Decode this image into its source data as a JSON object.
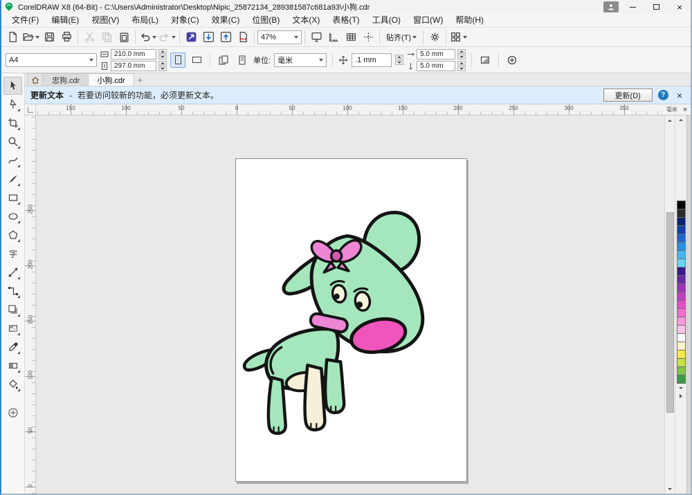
{
  "window": {
    "title": "CorelDRAW X8 (64-Bit) - C:\\Users\\Administrator\\Desktop\\Nipic_25872134_289381587c681a93\\小狗.cdr",
    "app_icon": "coreldraw-balloon-icon",
    "close_glyph": "×"
  },
  "menu": {
    "items": [
      "文件(F)",
      "编辑(E)",
      "视图(V)",
      "布局(L)",
      "对象(C)",
      "效果(C)",
      "位图(B)",
      "文本(X)",
      "表格(T)",
      "工具(O)",
      "窗口(W)",
      "帮助(H)"
    ]
  },
  "toolbar": {
    "zoom_level": "47%",
    "snap_label": "贴齐(T)"
  },
  "property_bar": {
    "page_size": "A4",
    "page_width": "210.0 mm",
    "page_height": "297.0 mm",
    "units_label": "单位:",
    "units_value": "毫米",
    "nudge_offset": ".1 mm",
    "duplicate_x": "5.0 mm",
    "duplicate_y": "5.0 mm"
  },
  "doc_tabs": {
    "tabs": [
      {
        "label": "忠狗.cdr"
      },
      {
        "label": "小狗.cdr"
      }
    ],
    "active_index": 1,
    "new_tab_glyph": "+"
  },
  "notification": {
    "title": "更新文本",
    "dash": "-",
    "message": "若要访问较新的功能，必须更新文本。",
    "action_label": "更新(D)",
    "help_glyph": "?",
    "close_glyph": "×"
  },
  "rulers": {
    "h_labels": [
      "150",
      "100",
      "50",
      "0",
      "50",
      "100",
      "150",
      "200",
      "250",
      "300",
      "350"
    ],
    "h_origin": 50,
    "h_step": 80,
    "v_labels": [
      "250",
      "200",
      "150",
      "100",
      "50",
      "0"
    ],
    "v_origin": 137,
    "v_step": 80,
    "unit_label": "毫米",
    "doc_close_glyph": "×"
  },
  "palette": {
    "colors": [
      "#000000",
      "#2b2b2b",
      "#0b216e",
      "#1440a8",
      "#1e66cc",
      "#2a8fe0",
      "#45b6f0",
      "#6ad4f5",
      "#3a1a8c",
      "#6a2aa8",
      "#9a35b8",
      "#c03ec0",
      "#e44fc4",
      "#f070cc",
      "#f79ad8",
      "#fbc4e8",
      "#ffffff",
      "#fdf3c8",
      "#f7e84a",
      "#c8e04a",
      "#7fc34a",
      "#3a9a4a"
    ]
  },
  "toolbox": {
    "tools": [
      "pick-tool",
      "shape-tool",
      "crop-tool",
      "zoom-tool",
      "freehand-tool",
      "artistic-media-tool",
      "rectangle-tool",
      "ellipse-tool",
      "polygon-tool",
      "text-tool",
      "parallel-dimension-tool",
      "connector-tool",
      "drop-shadow-tool",
      "transparency-tool",
      "color-eyedropper-tool",
      "interactive-fill-tool",
      "smart-fill-tool",
      "more-tools"
    ],
    "text_tool_glyph": "字"
  },
  "artwork": {
    "description": "cartoon dog with pink bow, pink collar and pink mouth on white A4 page",
    "body_color": "#a5e7bd",
    "outline_color": "#141414",
    "accent_pink": "#ee86d6",
    "accent_dark": "#d457b2",
    "mouth_pink": "#ef55bb",
    "cream": "#f6f0d8",
    "eye_white": "#f8f3dc"
  }
}
